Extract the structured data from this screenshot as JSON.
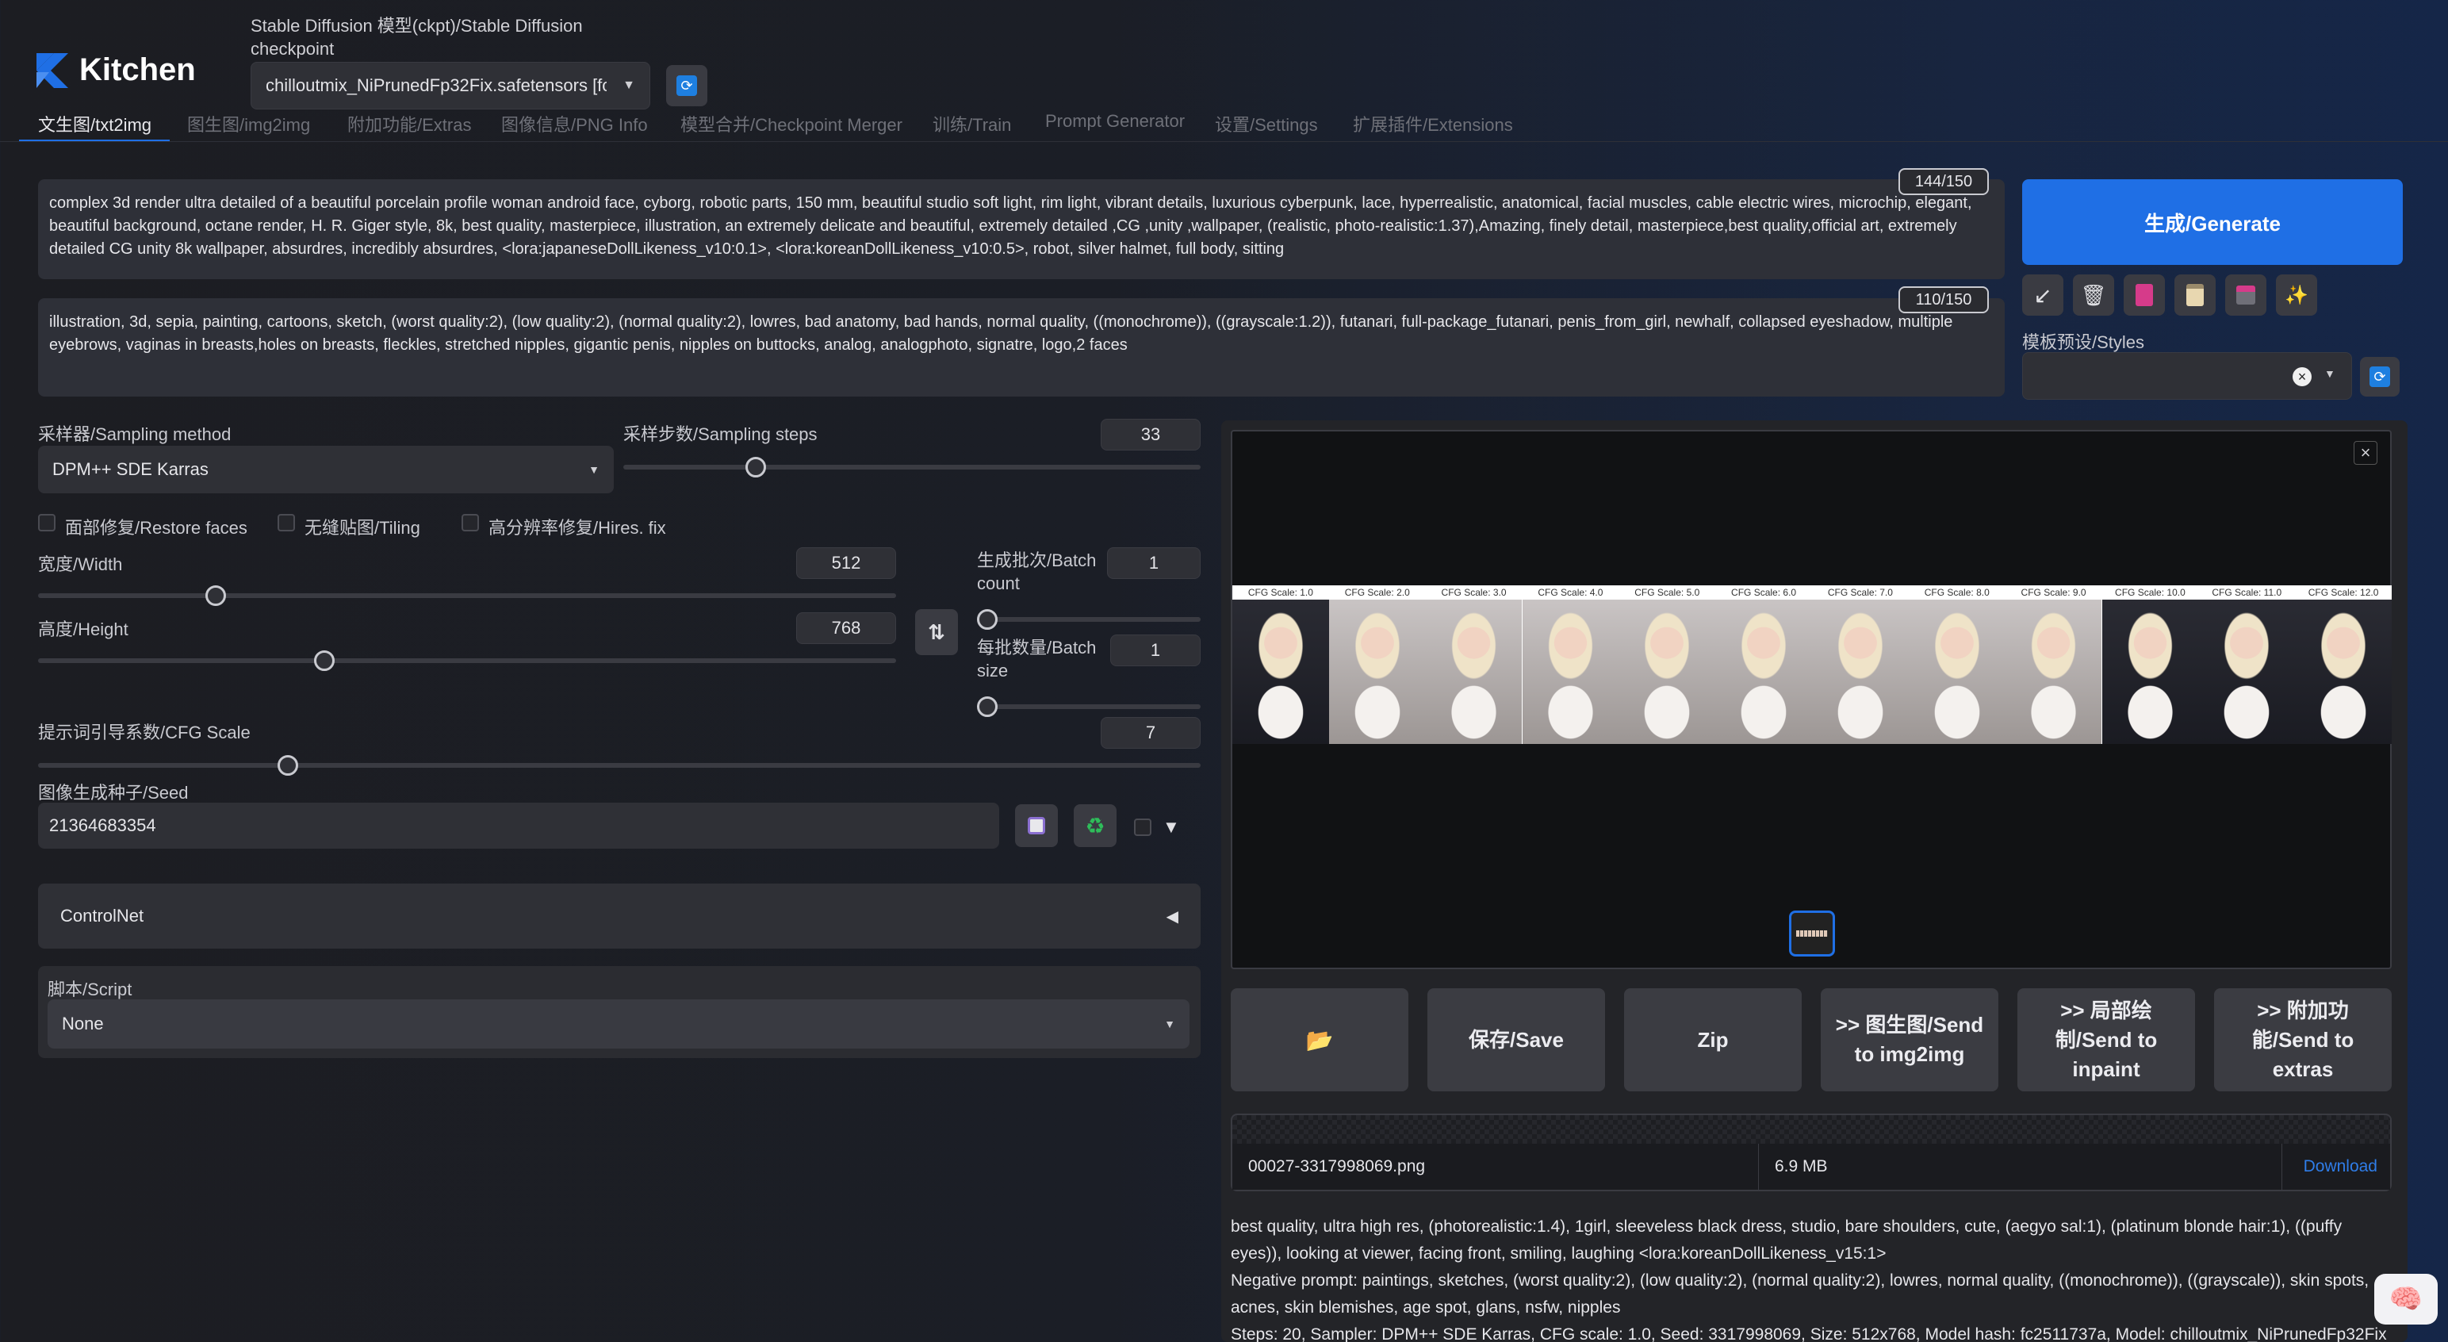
{
  "app": {
    "logo_text": "Kitchen"
  },
  "checkpoint": {
    "label": "Stable Diffusion 模型(ckpt)/Stable Diffusion checkpoint",
    "value": "chilloutmix_NiPrunedFp32Fix.safetensors [fc"
  },
  "tabs": [
    {
      "label": "文生图/txt2img",
      "active": true
    },
    {
      "label": "图生图/img2img"
    },
    {
      "label": "附加功能/Extras"
    },
    {
      "label": "图像信息/PNG Info"
    },
    {
      "label": "模型合并/Checkpoint Merger"
    },
    {
      "label": "训练/Train"
    },
    {
      "label": "Prompt Generator"
    },
    {
      "label": "设置/Settings"
    },
    {
      "label": "扩展插件/Extensions"
    }
  ],
  "prompt": {
    "text": "complex 3d render ultra detailed of a beautiful porcelain profile woman android face, cyborg, robotic parts, 150 mm, beautiful studio soft light, rim light, vibrant details, luxurious cyberpunk, lace, hyperrealistic, anatomical, facial muscles, cable electric wires, microchip, elegant, beautiful background, octane render, H. R. Giger style, 8k, best quality, masterpiece, illustration, an extremely delicate and beautiful, extremely detailed ,CG ,unity ,wallpaper, (realistic, photo-realistic:1.37),Amazing, finely detail, masterpiece,best quality,official art, extremely detailed CG unity 8k wallpaper, absurdres, incredibly absurdres,  <lora:japaneseDollLikeness_v10:0.1>, <lora:koreanDollLikeness_v10:0.5>, robot, silver halmet, full body, sitting",
    "token_count": "144/150"
  },
  "negative_prompt": {
    "text": "illustration, 3d, sepia, painting, cartoons, sketch, (worst quality:2), (low quality:2), (normal quality:2), lowres, bad anatomy, bad hands, normal quality, ((monochrome)), ((grayscale:1.2)), futanari, full-package_futanari, penis_from_girl, newhalf, collapsed eyeshadow, multiple eyebrows, vaginas in breasts,holes on breasts, fleckles, stretched nipples, gigantic penis, nipples on buttocks, analog, analogphoto, signatre, logo,2 faces",
    "token_count": "110/150"
  },
  "generate_button": "生成/Generate",
  "styles": {
    "label": "模板预设/Styles"
  },
  "sampling": {
    "method_label": "采样器/Sampling method",
    "method_value": "DPM++ SDE Karras",
    "steps_label": "采样步数/Sampling steps",
    "steps_value": "33",
    "steps_fraction": 0.22
  },
  "checkboxes": {
    "restore_faces": "面部修复/Restore faces",
    "tiling": "无缝贴图/Tiling",
    "hires_fix": "高分辨率修复/Hires. fix"
  },
  "width": {
    "label": "宽度/Width",
    "value": "512",
    "fraction": 0.2
  },
  "height": {
    "label": "高度/Height",
    "value": "768",
    "fraction": 0.33
  },
  "batch_count": {
    "label": "生成批次/Batch count",
    "value": "1",
    "fraction": 0
  },
  "batch_size": {
    "label": "每批数量/Batch size",
    "value": "1",
    "fraction": 0
  },
  "cfg": {
    "label": "提示词引导系数/CFG Scale",
    "value": "7",
    "fraction": 0.21
  },
  "seed": {
    "label": "图像生成种子/Seed",
    "value": "21364683354"
  },
  "controlnet": {
    "label": "ControlNet"
  },
  "script": {
    "label": "脚本/Script",
    "value": "None"
  },
  "gallery": {
    "cfg_labels": [
      "CFG Scale: 1.0",
      "CFG Scale: 2.0",
      "CFG Scale: 3.0",
      "CFG Scale: 4.0",
      "CFG Scale: 5.0",
      "CFG Scale: 6.0",
      "CFG Scale: 7.0",
      "CFG Scale: 8.0",
      "CFG Scale: 9.0",
      "CFG Scale: 10.0",
      "CFG Scale: 11.0",
      "CFG Scale: 12.0"
    ]
  },
  "actions": {
    "save": "保存/Save",
    "zip": "Zip",
    "send_img2img": ">> 图生图/Send to img2img",
    "send_inpaint": ">> 局部绘制/Send to inpaint",
    "send_extras": ">> 附加功能/Send to extras"
  },
  "file": {
    "name": "00027-3317998069.png",
    "size": "6.9 MB",
    "download": "Download"
  },
  "info": {
    "prompt": "best quality, ultra high res, (photorealistic:1.4), 1girl, sleeveless black dress, studio, bare shoulders, cute, (aegyo sal:1), (platinum blonde hair:1), ((puffy eyes)), looking at viewer, facing front, smiling, laughing <lora:koreanDollLikeness_v15:1>",
    "negative": "Negative prompt: paintings, sketches, (worst quality:2), (low quality:2), (normal quality:2), lowres, normal quality, ((monochrome)), ((grayscale)), skin spots, acnes, skin blemishes, age spot, glans, nsfw, nipples",
    "steps": "Steps: 20, Sampler: DPM++ SDE Karras, CFG scale: 1.0, Seed: 3317998069, Size: 512x768, Model hash: fc2511737a, Model: chilloutmix_NiPrunedFp32Fix"
  },
  "colors": {
    "accent": "#1f6fe5",
    "icon_accent": "#1e7fe0"
  }
}
